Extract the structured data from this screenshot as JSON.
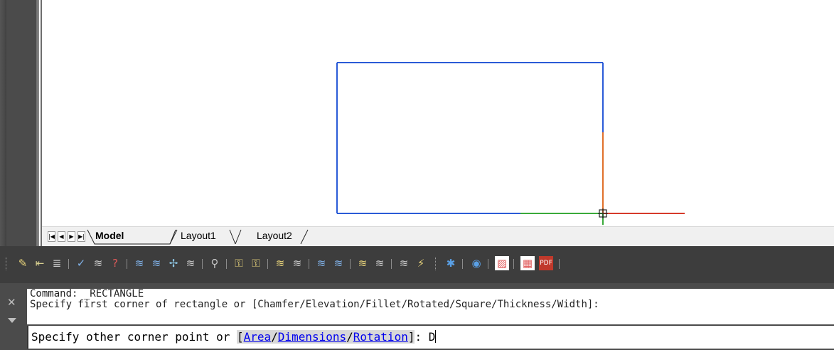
{
  "layout_tabs": {
    "nav_buttons": [
      "|◀",
      "◀",
      "▶",
      "▶|"
    ],
    "model_label": "Model",
    "layout1_label": "Layout1",
    "layout2_label": "Layout2"
  },
  "toolbar": {
    "icons": [
      "layer-properties-icon",
      "layer-previous-icon",
      "layer-states-icon",
      "layer-match-icon",
      "layer-change-icon",
      "layer-isolate-icon",
      "layer-freeze-icon",
      "layer-off-icon",
      "layer-on-icon",
      "layer-walk-icon",
      "layer-lock-icon",
      "layer-unlock-icon",
      "layer-merge-icon",
      "layer-delete-icon",
      "layer-thaw-icon",
      "layer-turn-all-on-icon",
      "layer-copy-icon",
      "layer-translate-icon",
      "layer-state-icon",
      "layer-filter-icon",
      "publish-web-icon",
      "globe-icon",
      "hatch-icon",
      "calendar-icon",
      "pdf-export-icon"
    ]
  },
  "command": {
    "history_line1": "Command: _RECTANGLE",
    "history_line2": "Specify first corner of rectangle or [Chamfer/Elevation/Fillet/Rotated/Square/Thickness/Width]:",
    "prompt_prefix": "Specify other corner point or ",
    "options": [
      "Area",
      "Dimensions",
      "Rotation"
    ],
    "prompt_suffix": ": ",
    "input_value": "D"
  },
  "colors": {
    "rectangle": "#2a5bd7",
    "x_axis": "#d63a2a",
    "y_axis": "#e0702a",
    "crosshair_green": "#3aaa3a"
  }
}
